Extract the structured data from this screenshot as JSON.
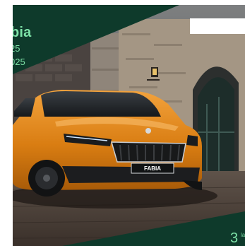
{
  "ad": {
    "headline": "bia",
    "line1": "25",
    "line2": "025",
    "corner_number": "3",
    "corner_small": "la",
    "plate_text": "FABIA"
  },
  "colors": {
    "brand_dark_green": "#0e3a2b",
    "brand_light_green": "#7ee2a8",
    "car_orange": "#e08a1f"
  },
  "icons": {
    "brand_badge": "skoda-logo-icon"
  }
}
